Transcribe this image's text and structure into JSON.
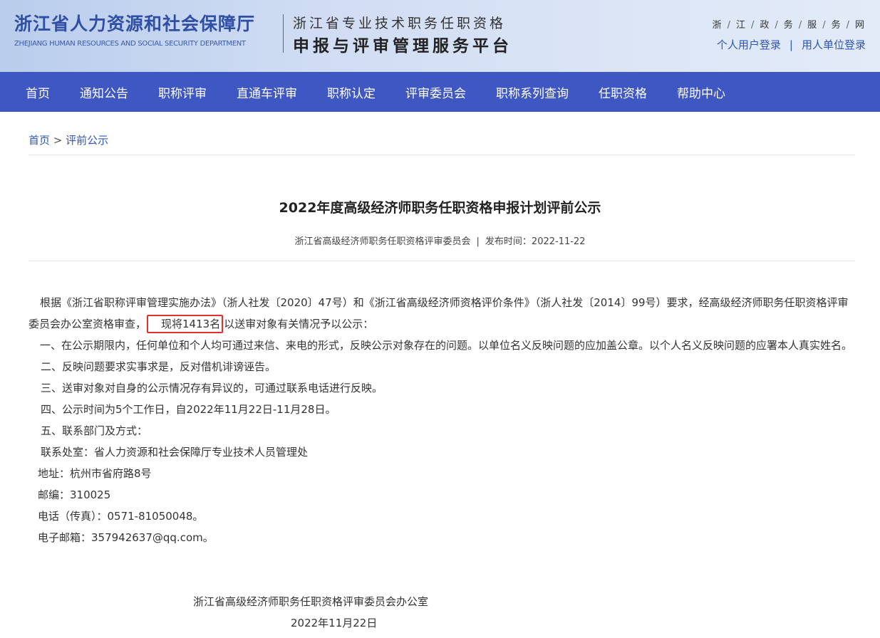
{
  "header": {
    "org_cn": "浙江省人力资源和社会保障厅",
    "org_en": "ZHEJIANG HUMAN RESOURCES AND SOCIAL SECURITY DEPARTMENT",
    "platform_line1": "浙江省专业技术职务任职资格",
    "platform_line2": "申报与评审管理服务平台",
    "zjzwfw_chars": [
      "浙",
      "江",
      "政",
      "务",
      "服",
      "务",
      "网"
    ],
    "zjzwfw_sep": "/",
    "login_personal": "个人用户登录",
    "login_sep": "|",
    "login_employer": "用人单位登录"
  },
  "nav": {
    "items": [
      "首页",
      "通知公告",
      "职称评审",
      "直通车评审",
      "职称认定",
      "评审委员会",
      "职称系列查询",
      "任职资格",
      "帮助中心"
    ]
  },
  "breadcrumb": {
    "home": "首页",
    "sep": " > ",
    "current": "评前公示"
  },
  "article": {
    "title": "2022年度高级经济师职务任职资格申报计划评前公示",
    "source": "浙江省高级经济师职务任职资格评审委员会",
    "meta_sep": "|",
    "publish_label": "发布时间：",
    "publish_date": "2022-11-22",
    "p1_before": "根据《浙江省职称评审管理实施办法》（浙人社发〔2020〕47号）和《浙江省高级经济师资格评价条件》（浙人社发〔2014〕99号）要求，经高级经济师职务任职资格评审委员会办公室资格审查，",
    "p1_highlight": "现将1413名",
    "p1_after": "以送审对象有关情况予以公示：",
    "p2": "一、在公示期限内，任何单位和个人均可通过来信、来电的形式，反映公示对象存在的问题。以单位名义反映问题的应加盖公章。以个人名义反映问题的应署本人真实姓名。",
    "p3": "二、反映问题要求实事求是，反对借机诽谤诬告。",
    "p4": "三、送审对象对自身的公示情况存有异议的，可通过联系电话进行反映。",
    "p5": "四、公示时间为5个工作日，自2022年11月22日-11月28日。",
    "p6": "五、联系部门及方式：",
    "contact_dept": "联系处室：省人力资源和社会保障厅专业技术人员管理处",
    "address": "地址：杭州市省府路8号",
    "postcode": "邮编：310025",
    "phone": "电话（传真）：0571-81050048。",
    "email": "电子邮箱：357942637@qq.com。",
    "sign_org": "浙江省高级经济师职务任职资格评审委员会办公室",
    "sign_date": "2022年11月22日"
  },
  "colors": {
    "nav_bg": "#3f57c2",
    "brand_blue": "#2f4fa6",
    "link_blue": "#2f56b8",
    "highlight_red": "#e03030"
  }
}
